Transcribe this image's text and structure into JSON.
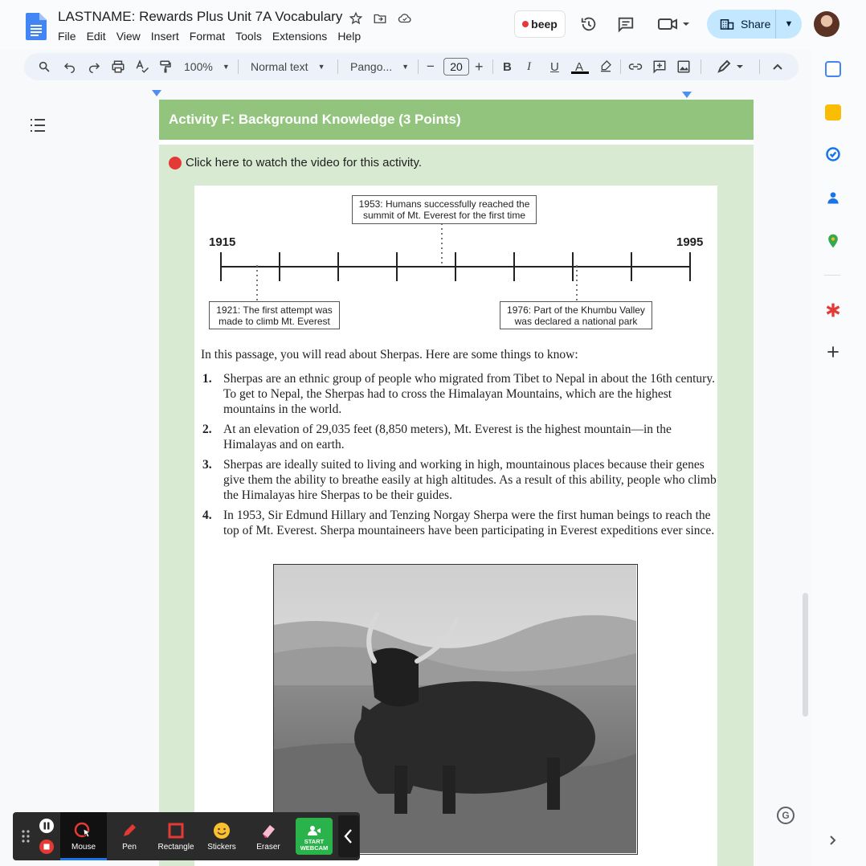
{
  "header": {
    "title": "LASTNAME: Rewards Plus Unit 7A Vocabulary",
    "menu": [
      "File",
      "Edit",
      "View",
      "Insert",
      "Format",
      "Tools",
      "Extensions",
      "Help"
    ],
    "beep_label": "beep",
    "share_label": "Share"
  },
  "toolbar": {
    "zoom": "100%",
    "style": "Normal text",
    "font": "Pango...",
    "font_size": "20",
    "minus": "−",
    "plus": "+",
    "bold": "B",
    "italic": "I",
    "underline": "U",
    "text_color": "A"
  },
  "document": {
    "activity_title": "Activity F: Background Knowledge (3 Points)",
    "video_link": "Click here to watch the video for this activity.",
    "timeline": {
      "start_year": "1915",
      "end_year": "1995",
      "events": [
        {
          "text": "1953: Humans successfully reached the summit of Mt. Everest for the first time"
        },
        {
          "text": "1921: The first attempt was made to climb Mt. Everest"
        },
        {
          "text": "1976: Part of the Khumbu Valley was declared a national park"
        }
      ]
    },
    "intro": "In this passage, you will read about Sherpas. Here are some things to know:",
    "items": [
      {
        "num": "1.",
        "text": "Sherpas are an ethnic group of people who migrated from Tibet to Nepal in about the 16th century. To get to Nepal, the Sherpas had to cross the Himalayan Mountains, which are the highest mountains in the world."
      },
      {
        "num": "2.",
        "text": "At an elevation of 29,035 feet (8,850 meters), Mt. Everest is the highest mountain—in the Himalayas and on earth."
      },
      {
        "num": "3.",
        "text": "Sherpas are ideally suited to living and working in high, mountainous places because their genes give them the ability to breathe easily at high altitudes. As a result of this ability, people who climb the Himalayas hire Sherpas to be their guides."
      },
      {
        "num": "4.",
        "text": "In 1953, Sir Edmund Hillary and Tenzing Norgay Sherpa were the first human beings to reach the top of Mt. Everest. Sherpa mountaineers have been participating in Everest expeditions ever since."
      }
    ]
  },
  "annotation_bar": {
    "tools": [
      "Mouse",
      "Pen",
      "Rectangle",
      "Stickers",
      "Eraser"
    ],
    "webcam_line1": "START",
    "webcam_line2": "WEBCAM"
  },
  "icons": {
    "grammarly": "G"
  },
  "colors": {
    "activity_header": "#93c47d",
    "activity_body": "#d9ead3",
    "share_button": "#c2e7ff",
    "webcam_button": "#29b34a"
  }
}
